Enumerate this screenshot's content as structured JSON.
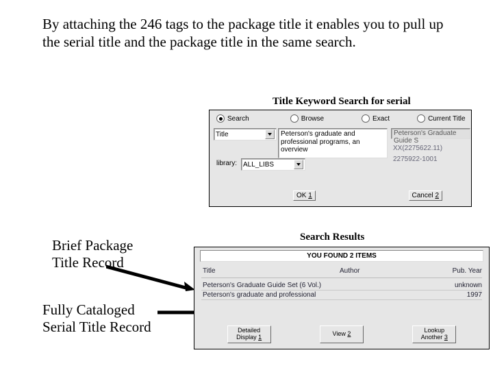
{
  "heading": "By attaching the 246 tags to the package title it enables you to pull up the serial title and the package title in the same search.",
  "caption_search": "Title Keyword Search for serial",
  "caption_results": "Search Results",
  "label_brief": "Brief Package\nTitle Record",
  "label_full": "Fully Cataloged\nSerial Title Record",
  "search": {
    "radios": {
      "search": "Search",
      "browse": "Browse",
      "exact": "Exact",
      "current": "Current Title"
    },
    "index_label": "Title",
    "query": "Peterson's graduate and professional programs, an overview",
    "result_preview": "Peterson's Graduate Guide S",
    "library_label": "library:",
    "library_value": "ALL_LIBS",
    "code1": "XX(2275622.11)",
    "code2": "2275922-1001",
    "ok": "OK",
    "ok_accel": "1",
    "cancel": "Cancel",
    "cancel_accel": "2"
  },
  "results": {
    "banner": "YOU FOUND 2 ITEMS",
    "cols": {
      "title": "Title",
      "author": "Author",
      "year": "Pub. Year"
    },
    "rows": [
      {
        "title": "Peterson's Graduate Guide Set (6 Vol.)",
        "author": "",
        "year": "unknown"
      },
      {
        "title": "Peterson's graduate and professional",
        "author": "",
        "year": "1997"
      }
    ],
    "btn_detail_l1": "Detailed",
    "btn_detail_l2": "Display",
    "btn_detail_accel": "1",
    "btn_view": "View",
    "btn_view_accel": "2",
    "btn_lookup_l1": "Lookup",
    "btn_lookup_l2": "Another",
    "btn_lookup_accel": "3"
  }
}
